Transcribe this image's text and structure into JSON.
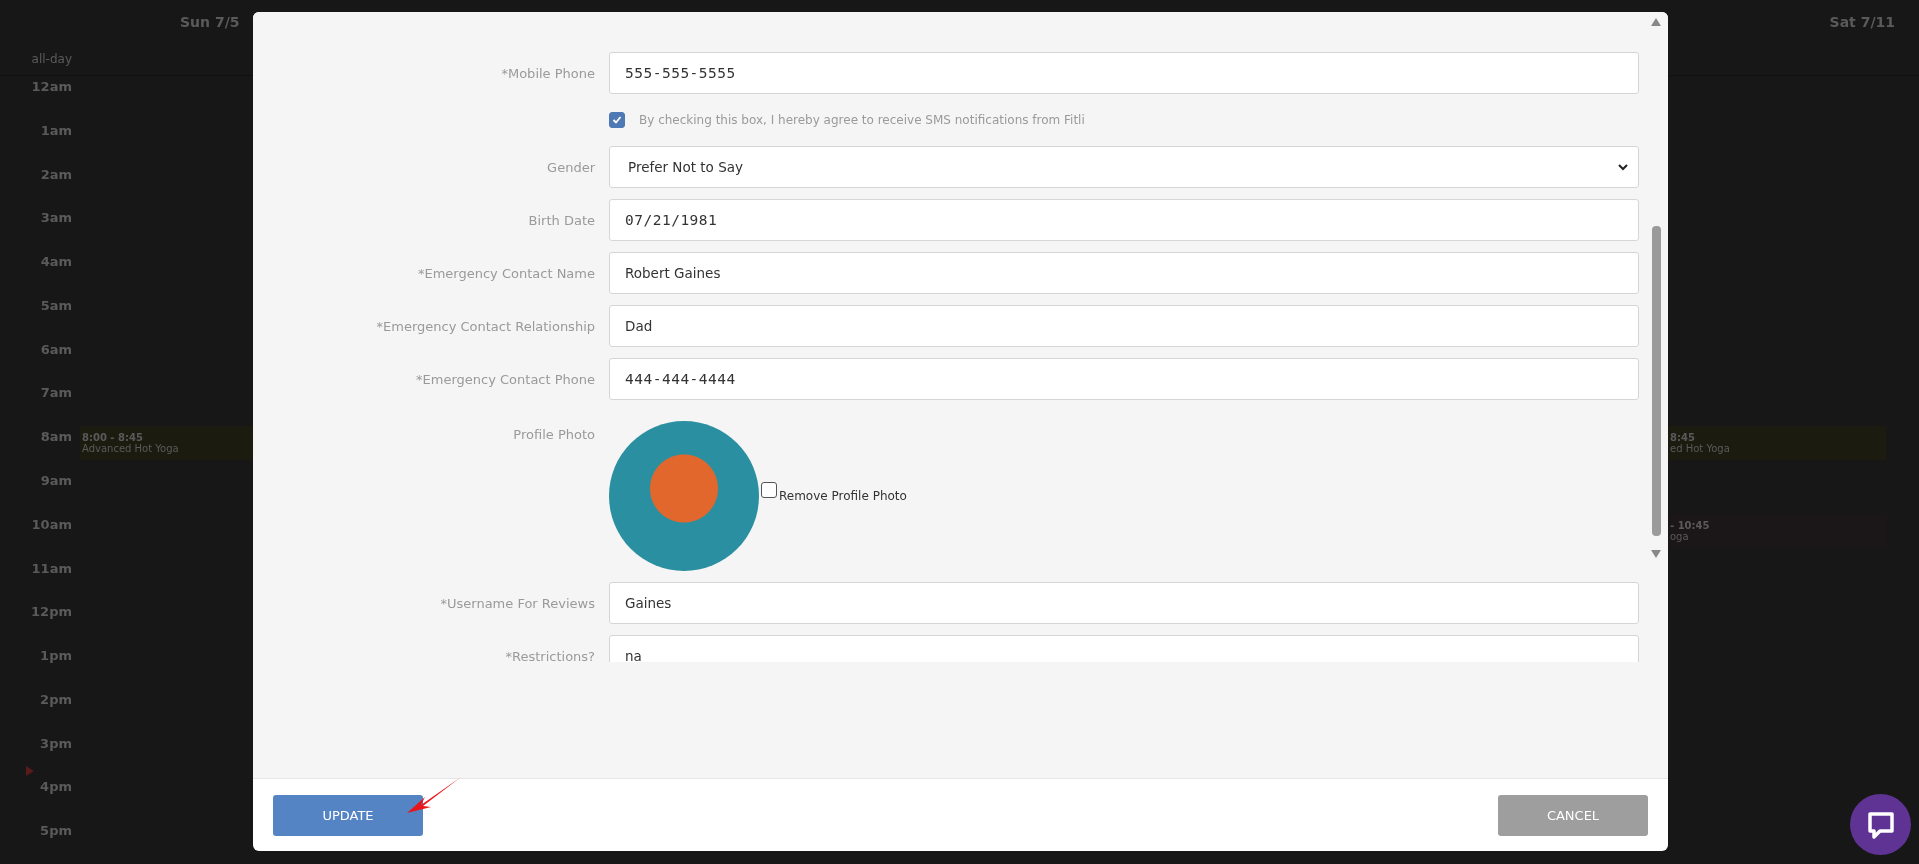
{
  "calendar": {
    "left_header": "Sun 7/5",
    "all_day_label": "all-day",
    "right_header": "Sat 7/11",
    "hours": [
      {
        "label": "12am"
      },
      {
        "label": "1am"
      },
      {
        "label": "2am"
      },
      {
        "label": "3am"
      },
      {
        "label": "4am"
      },
      {
        "label": "5am"
      },
      {
        "label": "6am"
      },
      {
        "label": "7am"
      },
      {
        "label": "8am",
        "left_event": {
          "time": "8:00 - 8:45",
          "title": "Advanced Hot Yoga",
          "color": "#1c1b10"
        },
        "right_event": {
          "time": "8:45",
          "title": "ed Hot Yoga",
          "color": "#1c1b10"
        }
      },
      {
        "label": "9am"
      },
      {
        "label": "10am",
        "right_event": {
          "time": "- 10:45",
          "title": "oga",
          "color": "#1b1618"
        }
      },
      {
        "label": "11am"
      },
      {
        "label": "12pm"
      },
      {
        "label": "1pm"
      },
      {
        "label": "2pm"
      },
      {
        "label": "3pm"
      },
      {
        "label": "4pm"
      },
      {
        "label": "5pm"
      }
    ]
  },
  "modal": {
    "fields": [
      {
        "kind": "tel",
        "label": "*Mobile Phone",
        "value": "555-555-5555"
      },
      {
        "kind": "consent",
        "label": "By checking this box, I hereby agree to receive SMS notifications from Fitli",
        "checked": true
      },
      {
        "kind": "select",
        "label": "Gender",
        "value": "Prefer Not to Say"
      },
      {
        "kind": "date",
        "label": "Birth Date",
        "value": "07/21/1981"
      },
      {
        "kind": "text",
        "label": "*Emergency Contact Name",
        "value": "Robert Gaines"
      },
      {
        "kind": "text",
        "label": "*Emergency Contact Relationship",
        "value": "Dad"
      },
      {
        "kind": "tel",
        "label": "*Emergency Contact Phone",
        "value": "444-444-4444"
      },
      {
        "kind": "photo",
        "label": "Profile Photo",
        "remove_label": "Remove Profile Photo",
        "checked": false
      },
      {
        "kind": "text",
        "label": "*Username For Reviews",
        "value": "Gaines"
      },
      {
        "kind": "text",
        "label": "*Restrictions?",
        "value": "na"
      }
    ],
    "buttons": [
      {
        "kind": "primary",
        "label": "UPDATE"
      },
      {
        "kind": "secondary",
        "label": "CANCEL"
      }
    ]
  }
}
